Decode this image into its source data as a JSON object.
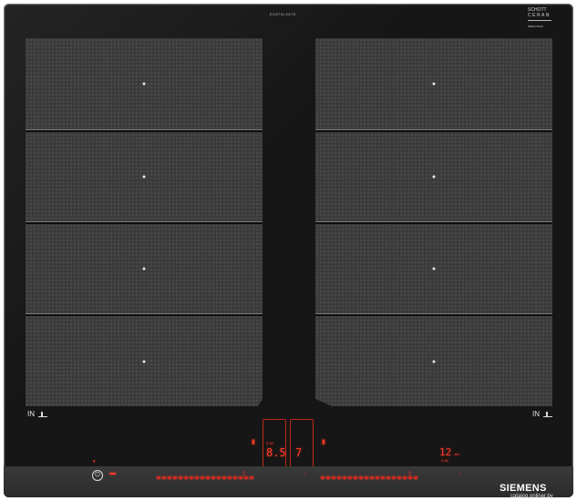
{
  "hob": {
    "top_label": "EX875LX67E",
    "glass_brand": {
      "line1": "SCHOTT",
      "line2": "CERAN",
      "line3": "INDUCTION"
    },
    "left_in_label": "IN",
    "right_in_label": "IN",
    "left_zones": [
      {
        "name": "left-zone-1"
      },
      {
        "name": "left-zone-2"
      },
      {
        "name": "left-zone-3"
      },
      {
        "name": "left-zone-4"
      }
    ],
    "right_zones": [
      {
        "name": "right-zone-1"
      },
      {
        "name": "right-zone-2"
      },
      {
        "name": "right-zone-3"
      },
      {
        "name": "right-zone-4"
      }
    ],
    "display": {
      "left_power_level": "8.5",
      "left_subscript": "3.40",
      "right_power_level": "7",
      "timer_value": "12",
      "timer_unit": "min",
      "timer_subscript": "3.40"
    },
    "power_symbol": "⏻",
    "brand": "SIEMENS",
    "colors": {
      "accent_red": "#ff3a2a",
      "glass": "#161616"
    }
  },
  "watermark": "catalog.onliner.by"
}
